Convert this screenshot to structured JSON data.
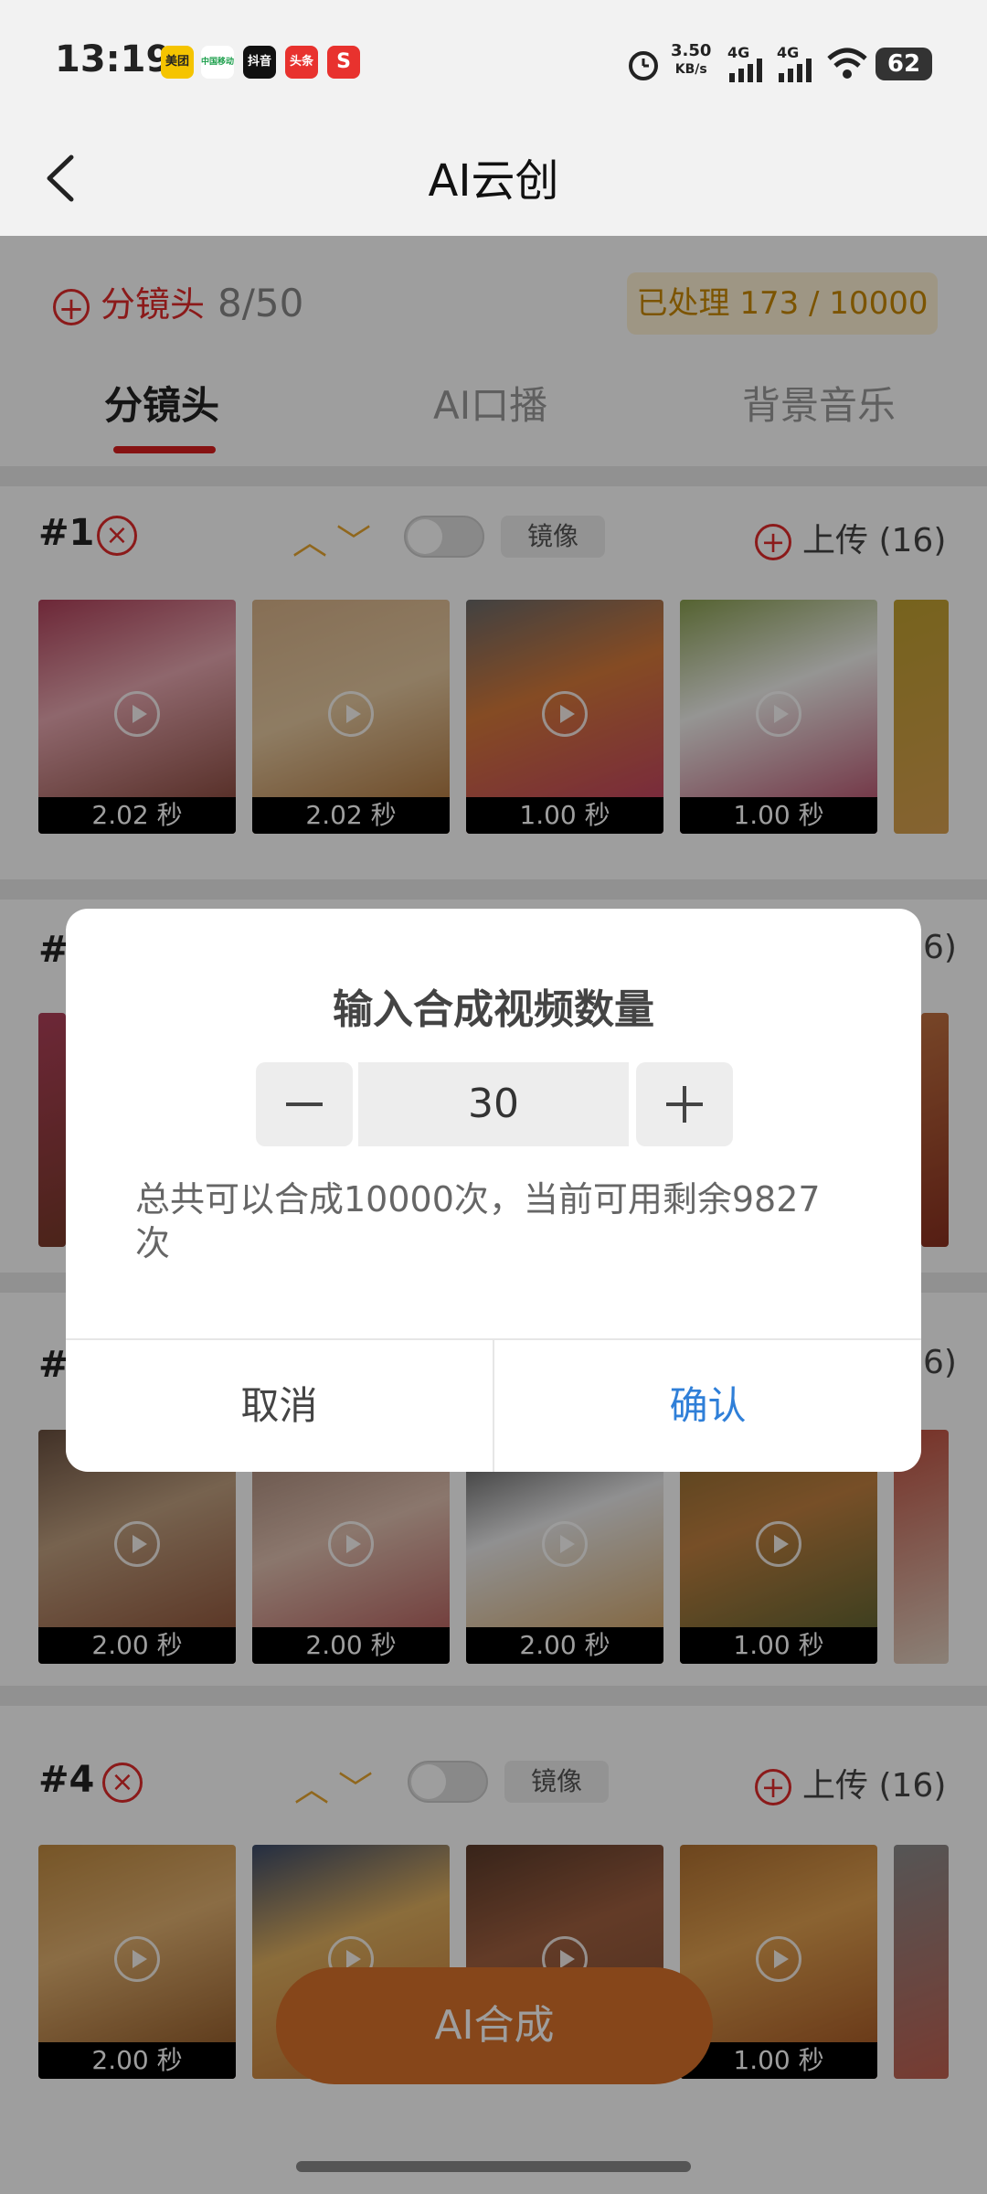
{
  "status_bar": {
    "time": "13:19",
    "apps": [
      "美团",
      "中国移动",
      "抖音",
      "头条",
      "S"
    ],
    "net_speed_value": "3.50",
    "net_speed_unit": "KB/s",
    "sig1": "4G",
    "sig2": "4G",
    "battery": "62"
  },
  "header": {
    "title": "AI云创"
  },
  "topbar": {
    "add_label": "分镜头",
    "count": "8/50",
    "processed": "已处理 173 / 10000"
  },
  "tabs": [
    "分镜头",
    "AI口播",
    "背景音乐"
  ],
  "shot_labels": [
    "#1",
    "#",
    "#",
    "#4"
  ],
  "mirror_label": "镜像",
  "upload_label": "上传",
  "upload_count": "(16)",
  "partial_counts": [
    "6)",
    "6)"
  ],
  "rows": [
    {
      "durations": [
        "2.02 秒",
        "2.02 秒",
        "1.00 秒",
        "1.00 秒"
      ]
    },
    {
      "durations": [
        "2.00 秒",
        "2.00 秒",
        "2.00 秒",
        "1.00 秒"
      ]
    },
    {
      "durations": [
        "2.00 秒",
        "",
        "",
        "1.00 秒"
      ]
    }
  ],
  "dialog": {
    "title": "输入合成视频数量",
    "value": "30",
    "message": "总共可以合成10000次，当前可用剩余9827次",
    "cancel": "取消",
    "confirm": "确认"
  },
  "ai_button": "AI合成",
  "colors": {
    "accent_red": "#e02a2a",
    "confirm_blue": "#2f7fd8",
    "ai_button": "#d8722a",
    "processed_text": "#c98800"
  }
}
